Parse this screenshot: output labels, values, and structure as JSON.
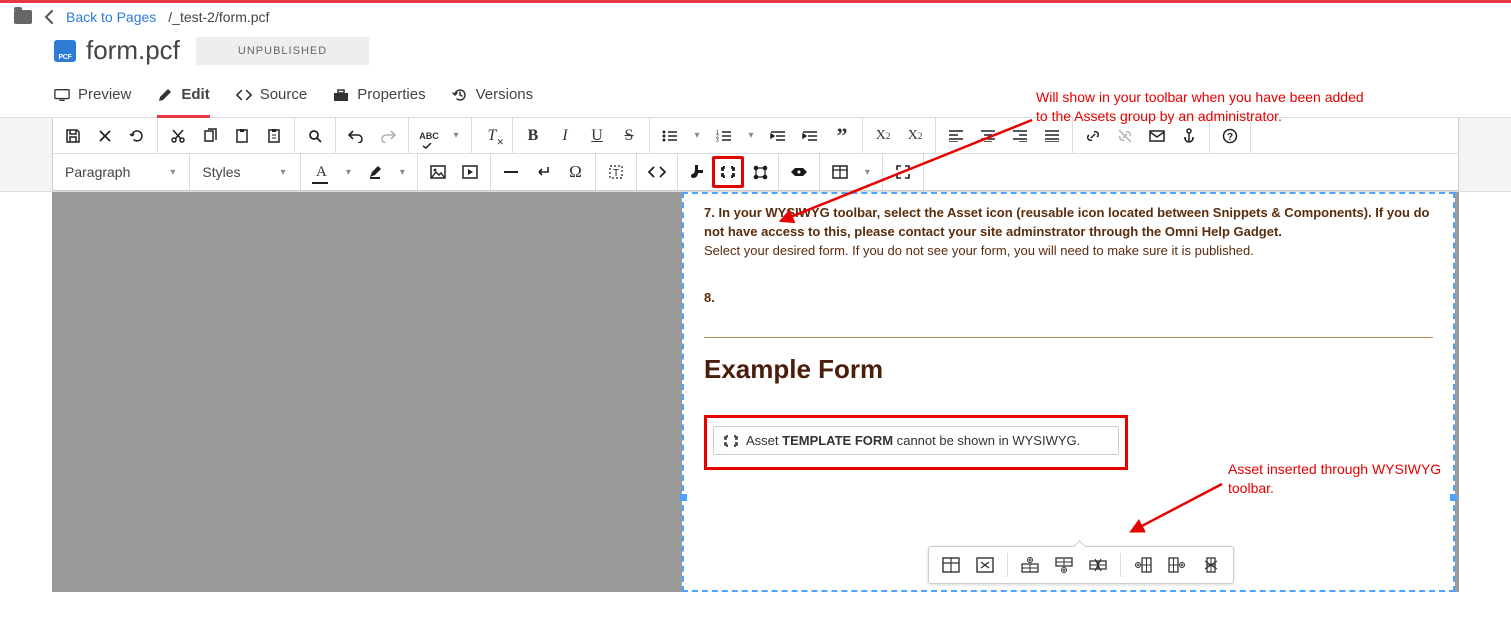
{
  "breadcrumb": {
    "back_label": "Back to Pages",
    "path": "/_test-2/form.pcf"
  },
  "page": {
    "title": "form.pcf",
    "status": "UNPUBLISHED"
  },
  "tabs": {
    "preview": "Preview",
    "edit": "Edit",
    "source": "Source",
    "properties": "Properties",
    "versions": "Versions"
  },
  "toolbar": {
    "paragraph": "Paragraph",
    "styles": "Styles",
    "abc": "ABC"
  },
  "content": {
    "step7_bold": "7. In your WYSIWYG toolbar, select the Asset icon (reusable icon located between Snippets & Components). If you do not have access to this, please contact your site adminstrator through the Omni Help Gadget.",
    "step7_sub": "Select your desired form. If you do not see your form, you will need to make sure it is published.",
    "step8": "8.",
    "example_heading": "Example Form",
    "asset_prefix": "Asset ",
    "asset_name": "TEMPLATE FORM",
    "asset_suffix": " cannot be shown in WYSIWYG."
  },
  "annotations": {
    "a1": "Will show in your toolbar when you have been added to the Assets group by an administrator.",
    "a2": "Asset inserted through WYSIWYG toolbar."
  },
  "colors": {
    "accent": "#e63946",
    "link": "#2e7cd6",
    "annot": "#e60000",
    "brown": "#5a2d0d"
  }
}
